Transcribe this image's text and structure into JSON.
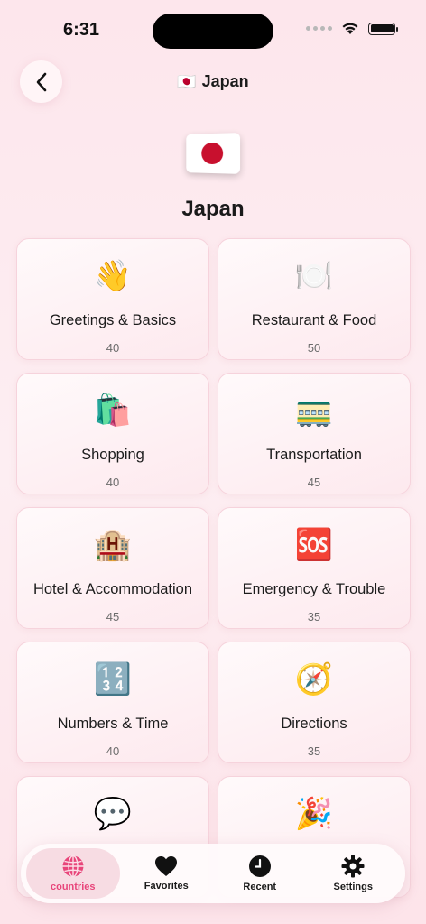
{
  "status_bar": {
    "time": "6:31"
  },
  "header": {
    "flag": "🇯🇵",
    "title": "Japan"
  },
  "hero": {
    "title": "Japan"
  },
  "categories": [
    {
      "emoji": "👋",
      "label": "Greetings & Basics",
      "count": "40"
    },
    {
      "emoji": "🍽️",
      "label": "Restaurant & Food",
      "count": "50"
    },
    {
      "emoji": "🛍️",
      "label": "Shopping",
      "count": "40"
    },
    {
      "emoji": "🚃",
      "label": "Transportation",
      "count": "45"
    },
    {
      "emoji": "🏨",
      "label": "Hotel & Accommodation",
      "count": "45"
    },
    {
      "emoji": "🆘",
      "label": "Emergency & Trouble",
      "count": "35"
    },
    {
      "emoji": "🔢",
      "label": "Numbers & Time",
      "count": "40"
    },
    {
      "emoji": "🧭",
      "label": "Directions",
      "count": "35"
    },
    {
      "emoji": "💬",
      "label": "",
      "count": ""
    },
    {
      "emoji": "🎉",
      "label": "",
      "count": ""
    }
  ],
  "tab_bar": {
    "tabs": [
      {
        "label": "countries",
        "icon": "globe-icon",
        "active": true
      },
      {
        "label": "Favorites",
        "icon": "heart-icon",
        "active": false
      },
      {
        "label": "Recent",
        "icon": "clock-icon",
        "active": false
      },
      {
        "label": "Settings",
        "icon": "gear-icon",
        "active": false
      }
    ]
  },
  "colors": {
    "accent": "#e8457a",
    "background": "#fde6ec",
    "japan_red": "#c8102e"
  }
}
